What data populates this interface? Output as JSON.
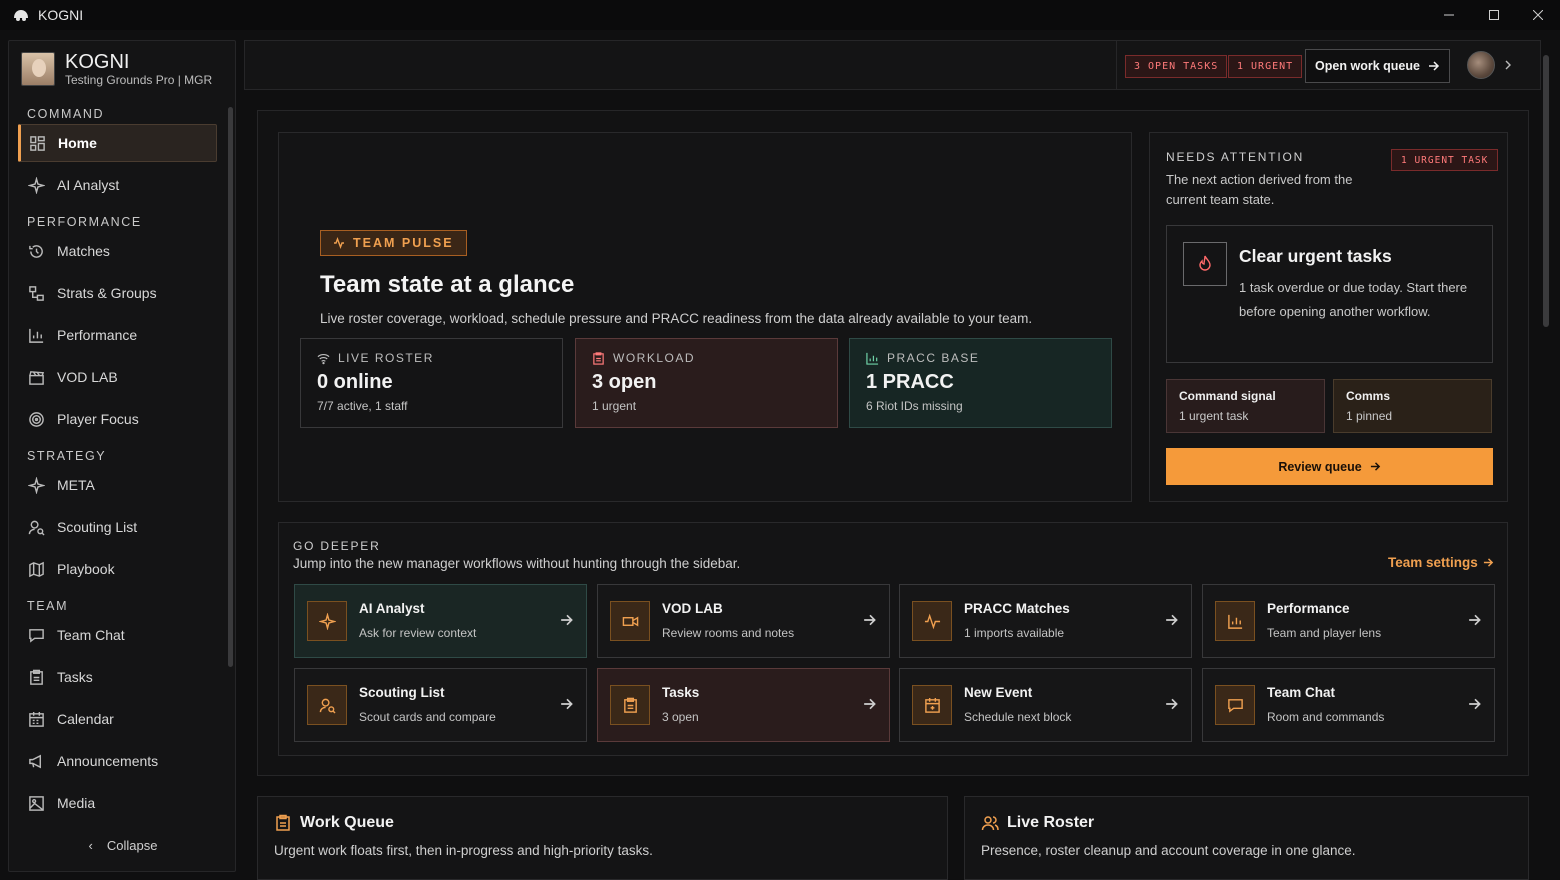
{
  "window": {
    "title": "KOGNI"
  },
  "brand": {
    "name": "KOGNI",
    "subtitle": "Testing Grounds Pro | MGR"
  },
  "sidebar": {
    "sections": {
      "command": "COMMAND",
      "performance": "PERFORMANCE",
      "strategy": "STRATEGY",
      "team": "TEAM"
    },
    "items": [
      {
        "label": "Home",
        "icon": "grid-icon",
        "active": true
      },
      {
        "label": "AI Analyst",
        "icon": "sparkle-icon"
      },
      {
        "label": "Matches",
        "icon": "history-icon"
      },
      {
        "label": "Strats & Groups",
        "icon": "strats-icon"
      },
      {
        "label": "Performance",
        "icon": "bar-chart-icon"
      },
      {
        "label": "VOD LAB",
        "icon": "clapper-icon"
      },
      {
        "label": "Player Focus",
        "icon": "target-icon"
      },
      {
        "label": "META",
        "icon": "sparkle-icon"
      },
      {
        "label": "Scouting List",
        "icon": "user-search-icon"
      },
      {
        "label": "Playbook",
        "icon": "map-icon"
      },
      {
        "label": "Team Chat",
        "icon": "chat-icon"
      },
      {
        "label": "Tasks",
        "icon": "clipboard-icon"
      },
      {
        "label": "Calendar",
        "icon": "calendar-icon"
      },
      {
        "label": "Announcements",
        "icon": "megaphone-icon"
      },
      {
        "label": "Media",
        "icon": "image-icon"
      }
    ],
    "collapse_label": "Collapse"
  },
  "topbar": {
    "open_tasks": "3 OPEN TASKS",
    "urgent": "1 URGENT",
    "work_queue_button": "Open work queue"
  },
  "pulse": {
    "tag": "TEAM PULSE",
    "title": "Team state at a glance",
    "description": "Live roster coverage, workload, schedule pressure and PRACC readiness from the data already available to your team.",
    "stats": [
      {
        "label": "LIVE ROSTER",
        "value": "0 online",
        "sub": "7/7 active, 1 staff",
        "icon": "wifi-icon"
      },
      {
        "label": "WORKLOAD",
        "value": "3 open",
        "sub": "1 urgent",
        "icon": "clipboard-icon"
      },
      {
        "label": "PRACC BASE",
        "value": "1 PRACC",
        "sub": "6 Riot IDs missing",
        "icon": "bar-chart-icon"
      }
    ]
  },
  "attention": {
    "title": "NEEDS ATTENTION",
    "description": "The next action derived from the current team state.",
    "tag": "1 URGENT TASK",
    "card_title": "Clear urgent tasks",
    "card_desc": "1 task overdue or due today. Start there before opening another workflow.",
    "mini": [
      {
        "title": "Command signal",
        "sub": "1 urgent task"
      },
      {
        "title": "Comms",
        "sub": "1 pinned"
      }
    ],
    "button": "Review queue"
  },
  "deeper": {
    "title": "GO DEEPER",
    "description": "Jump into the new manager workflows without hunting through the sidebar.",
    "settings_link": "Team settings",
    "cards": [
      {
        "title": "AI Analyst",
        "sub": "Ask for review context",
        "icon": "sparkle-icon"
      },
      {
        "title": "VOD LAB",
        "sub": "Review rooms and notes",
        "icon": "video-icon"
      },
      {
        "title": "PRACC Matches",
        "sub": "1 imports available",
        "icon": "pulse-icon"
      },
      {
        "title": "Performance",
        "sub": "Team and player lens",
        "icon": "bar-chart-icon"
      },
      {
        "title": "Scouting List",
        "sub": "Scout cards and compare",
        "icon": "user-search-icon"
      },
      {
        "title": "Tasks",
        "sub": "3 open",
        "icon": "clipboard-icon"
      },
      {
        "title": "New Event",
        "sub": "Schedule next block",
        "icon": "calendar-plus-icon"
      },
      {
        "title": "Team Chat",
        "sub": "Room and commands",
        "icon": "chat-icon"
      }
    ]
  },
  "bottom": {
    "work_queue": {
      "title": "Work Queue",
      "description": "Urgent work floats first, then in-progress and high-priority tasks."
    },
    "live_roster": {
      "title": "Live Roster",
      "description": "Presence, roster cleanup and account coverage in one glance."
    }
  }
}
